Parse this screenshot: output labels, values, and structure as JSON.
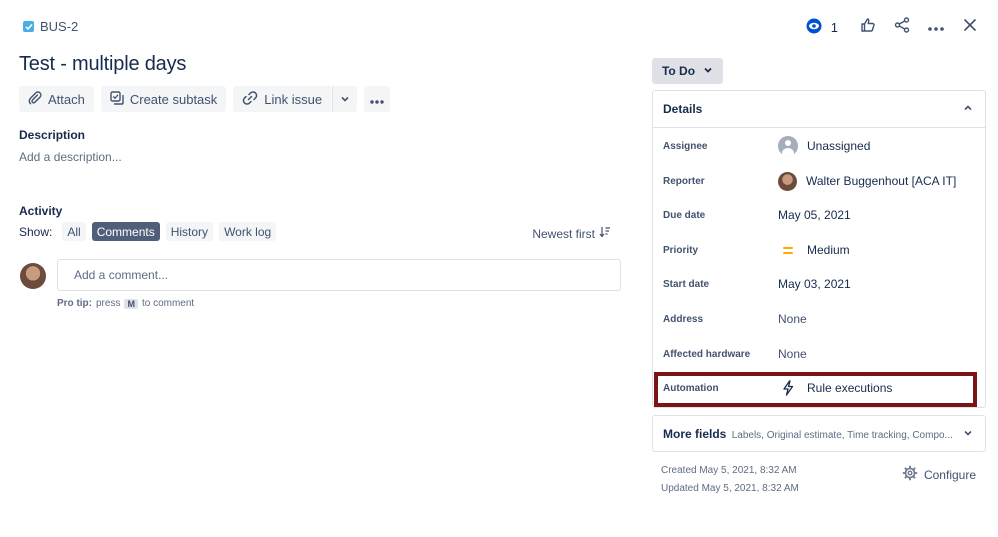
{
  "header": {
    "issue_key": "BUS-2",
    "title": "Test - multiple days",
    "watch_count": "1"
  },
  "toolbar": {
    "attach_label": "Attach",
    "create_subtask_label": "Create subtask",
    "link_issue_label": "Link issue"
  },
  "description": {
    "heading": "Description",
    "placeholder": "Add a description..."
  },
  "activity": {
    "heading": "Activity",
    "show_label": "Show:",
    "filters": [
      "All",
      "Comments",
      "History",
      "Work log"
    ],
    "active_filter": "Comments",
    "sort_label": "Newest first",
    "comment_placeholder": "Add a comment...",
    "protip_bold": "Pro tip:",
    "protip_press": "press",
    "protip_key": "M",
    "protip_tail": "to comment"
  },
  "status": {
    "label": "To Do"
  },
  "details": {
    "heading": "Details",
    "fields": [
      {
        "label": "Assignee",
        "value": "Unassigned"
      },
      {
        "label": "Reporter",
        "value": "Walter Buggenhout [ACA IT]"
      },
      {
        "label": "Due date",
        "value": "May 05, 2021"
      },
      {
        "label": "Priority",
        "value": "Medium"
      },
      {
        "label": "Start date",
        "value": "May 03, 2021"
      },
      {
        "label": "Address",
        "value": "None"
      },
      {
        "label": "Affected hardware",
        "value": "None"
      },
      {
        "label": "Automation",
        "value": "Rule executions"
      }
    ]
  },
  "more_fields": {
    "title": "More fields",
    "subtitle": "Labels, Original estimate, Time tracking, Compo..."
  },
  "meta": {
    "created": "Created May 5, 2021, 8:32 AM",
    "updated": "Updated May 5, 2021, 8:32 AM",
    "configure_label": "Configure"
  },
  "colors": {
    "highlight_border": "#7b1414",
    "priority_medium": "#ffab00",
    "active_chip": "#505f79",
    "issue_type": "#4bade8"
  }
}
